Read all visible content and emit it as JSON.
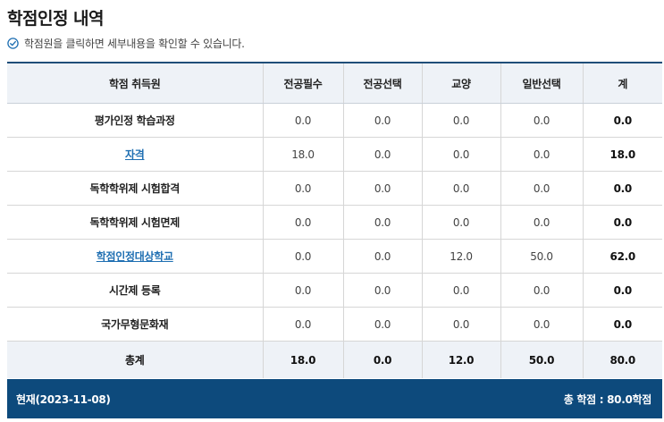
{
  "page": {
    "title": "학점인정 내역",
    "notice": "학점원을 클릭하면 세부내용을 확인할 수 있습니다."
  },
  "table": {
    "headers": [
      "학점 취득원",
      "전공필수",
      "전공선택",
      "교양",
      "일반선택",
      "계"
    ],
    "rows": [
      {
        "source": "평가인정 학습과정",
        "link": false,
        "values": [
          "0.0",
          "0.0",
          "0.0",
          "0.0"
        ],
        "total": "0.0"
      },
      {
        "source": "자격",
        "link": true,
        "values": [
          "18.0",
          "0.0",
          "0.0",
          "0.0"
        ],
        "total": "18.0"
      },
      {
        "source": "독학학위제 시험합격",
        "link": false,
        "values": [
          "0.0",
          "0.0",
          "0.0",
          "0.0"
        ],
        "total": "0.0"
      },
      {
        "source": "독학학위제 시험면제",
        "link": false,
        "values": [
          "0.0",
          "0.0",
          "0.0",
          "0.0"
        ],
        "total": "0.0"
      },
      {
        "source": "학점인정대상학교",
        "link": true,
        "values": [
          "0.0",
          "0.0",
          "12.0",
          "50.0"
        ],
        "total": "62.0"
      },
      {
        "source": "시간제 등록",
        "link": false,
        "values": [
          "0.0",
          "0.0",
          "0.0",
          "0.0"
        ],
        "total": "0.0"
      },
      {
        "source": "국가무형문화재",
        "link": false,
        "values": [
          "0.0",
          "0.0",
          "0.0",
          "0.0"
        ],
        "total": "0.0"
      }
    ],
    "summary": {
      "label": "총계",
      "values": [
        "18.0",
        "0.0",
        "12.0",
        "50.0"
      ],
      "total": "80.0"
    }
  },
  "footer": {
    "date": "현재(2023-11-08)",
    "total_credits": "총 학점 : 80.0학점"
  },
  "colors": {
    "accent": "#0d4a7c",
    "link": "#1f6fb2",
    "header_bg": "#eef2f7"
  },
  "icons": {
    "notice": "check-circle-icon"
  }
}
